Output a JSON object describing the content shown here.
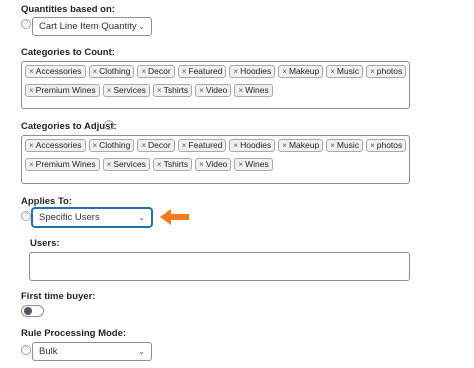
{
  "quantities": {
    "label": "Quantities based on:",
    "help_icon": "?",
    "value": "Cart Line Item Quantity"
  },
  "categories_to_count": {
    "label": "Categories to Count:",
    "tags_row1": [
      "Accessories",
      "Clothing",
      "Decor",
      "Featured",
      "Hoodies",
      "Makeup",
      "Music",
      "photos"
    ],
    "tags_row2": [
      "Premium Wines",
      "Services",
      "Tshirts",
      "Video",
      "Wines"
    ]
  },
  "categories_to_adjust": {
    "label": "Categories to Adjust:",
    "help_icon": "?",
    "tags_row1": [
      "Accessories",
      "Clothing",
      "Decor",
      "Featured",
      "Hoodies",
      "Makeup",
      "Music",
      "photos"
    ],
    "tags_row2": [
      "Premium Wines",
      "Services",
      "Tshirts",
      "Video",
      "Wines"
    ]
  },
  "applies_to": {
    "label": "Applies To:",
    "help_icon": "?",
    "value": "Specific Users",
    "arrow_color": "#f47c20"
  },
  "users": {
    "label": "Users:",
    "value": ""
  },
  "first_time_buyer": {
    "label": "First time buyer:",
    "enabled": false
  },
  "rule_processing": {
    "label": "Rule Processing Mode:",
    "help_icon": "?",
    "value": "Bulk"
  },
  "tag_remove_glyph": "×",
  "accent_color": "#2271b1"
}
